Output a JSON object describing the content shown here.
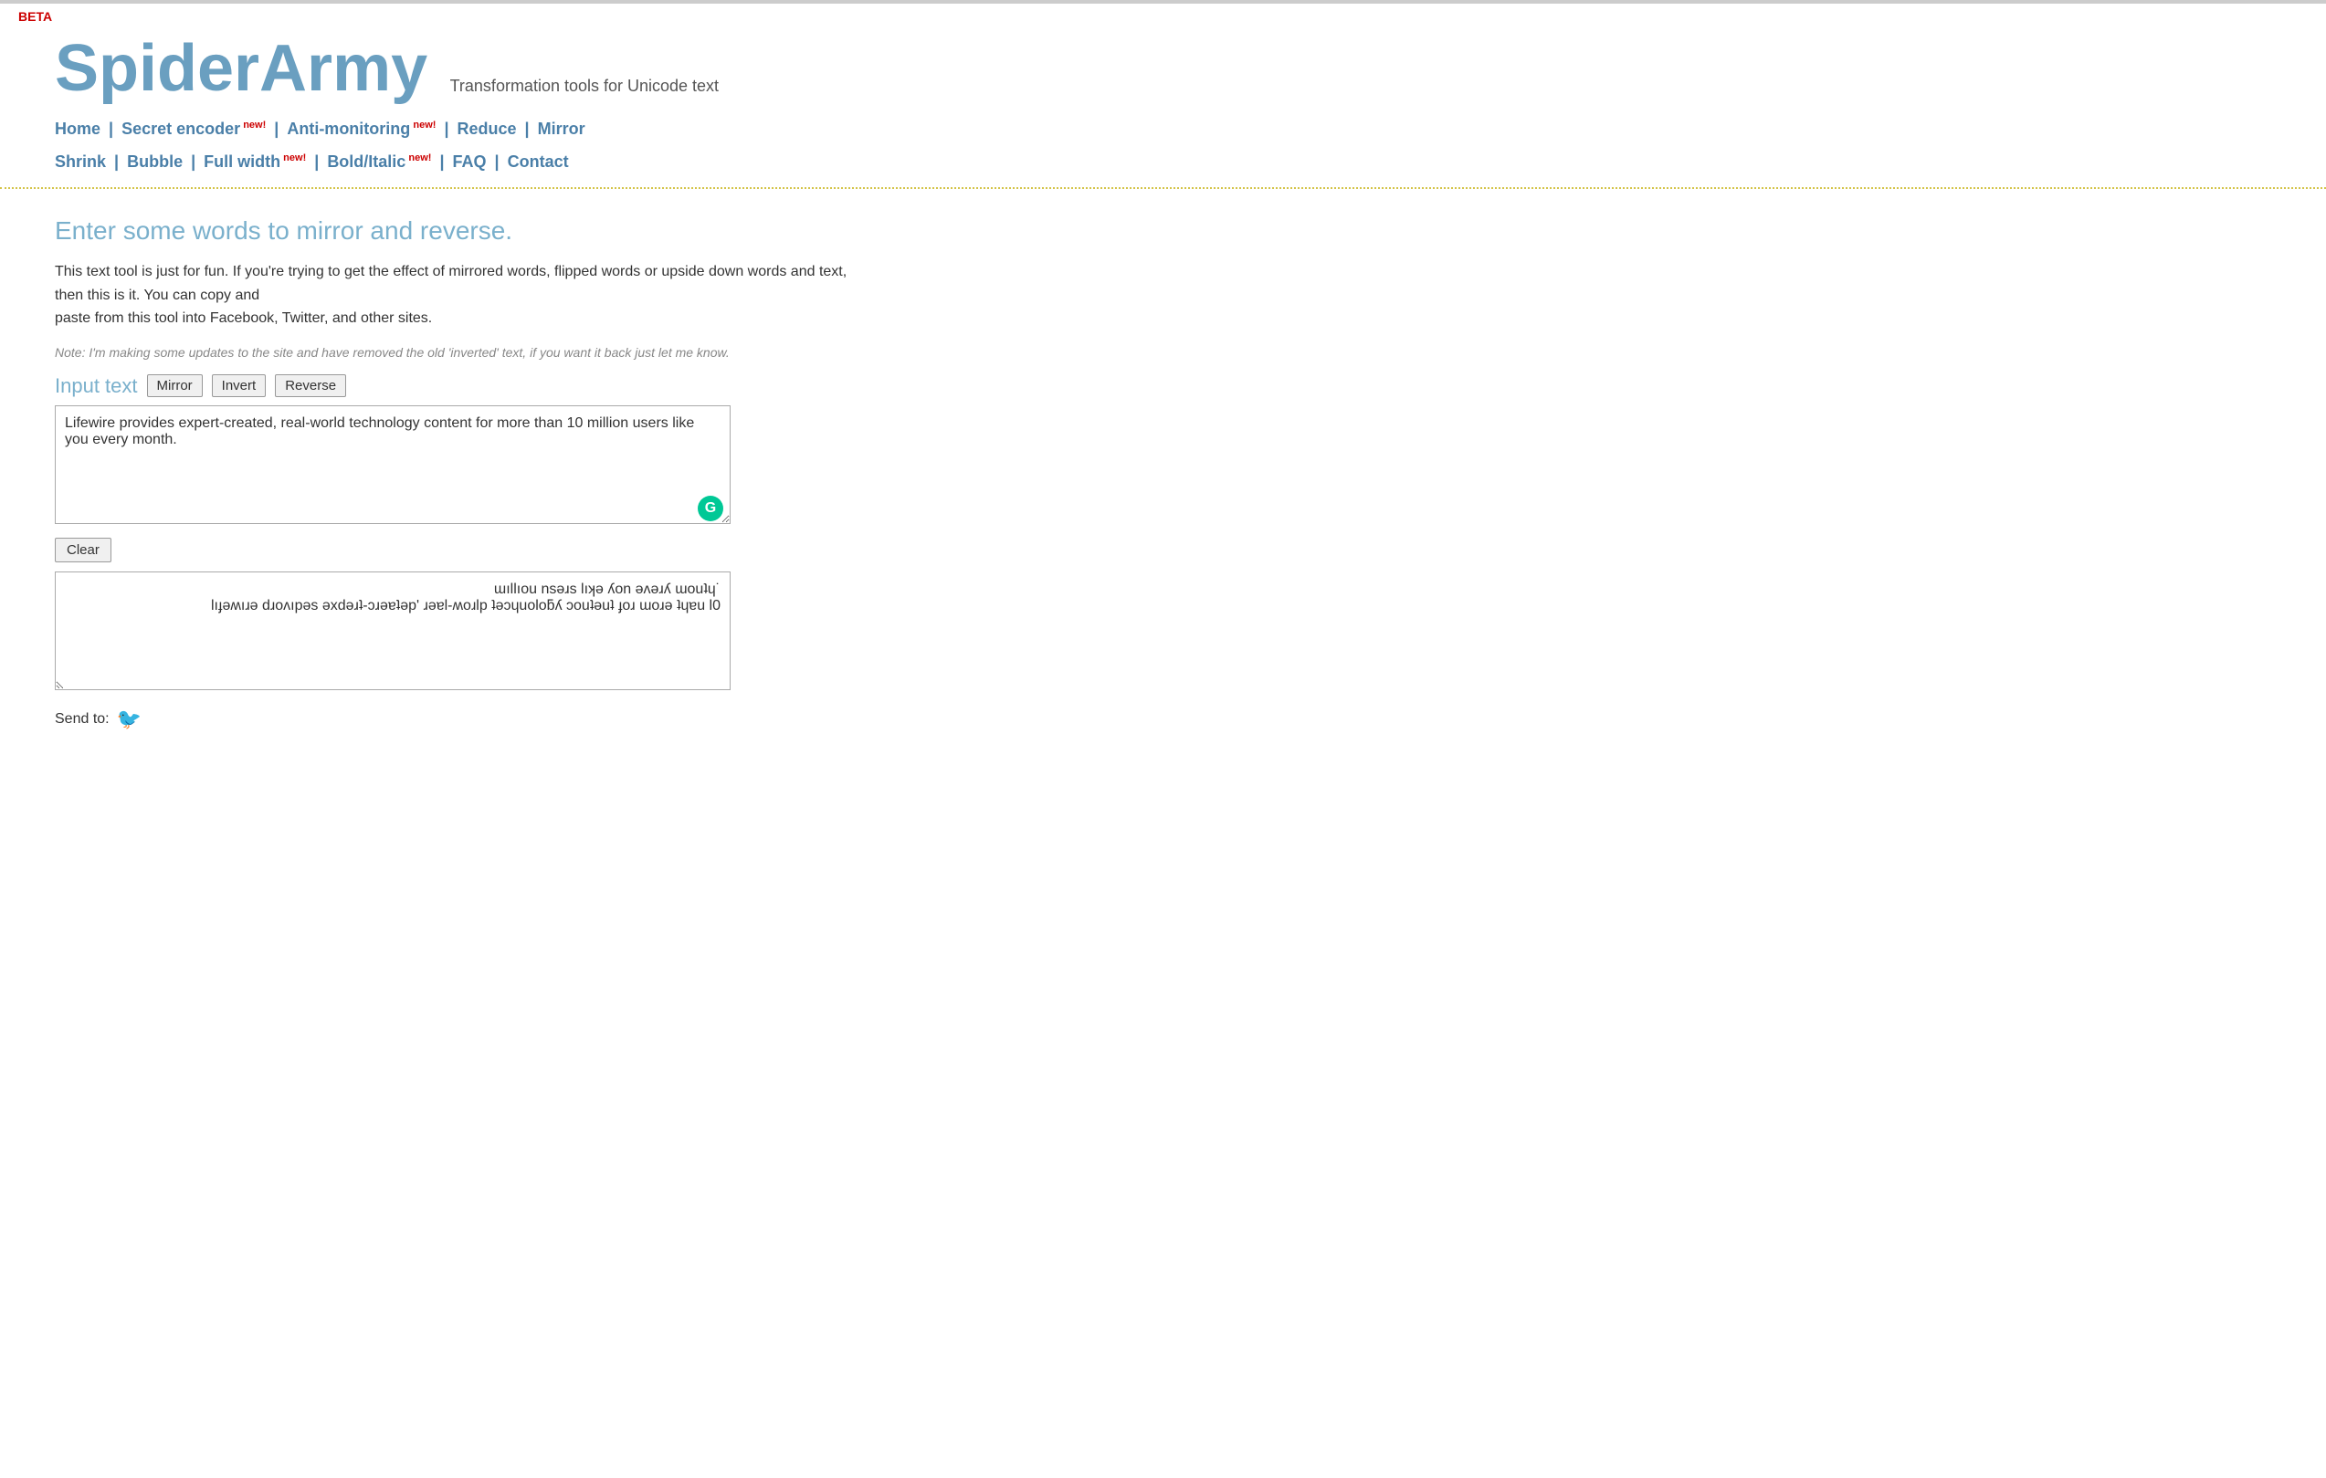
{
  "meta": {
    "beta_label": "BETA",
    "top_border": true
  },
  "header": {
    "site_title": "SpiderArmy",
    "tagline": "Transformation tools for Unicode text"
  },
  "nav": {
    "row1": [
      {
        "label": "Home",
        "new": false
      },
      {
        "label": "Secret encoder",
        "new": true
      },
      {
        "label": "Anti-monitoring",
        "new": true
      },
      {
        "label": "Reduce",
        "new": false
      },
      {
        "label": "Mirror",
        "new": false
      }
    ],
    "row2": [
      {
        "label": "Shrink",
        "new": false
      },
      {
        "label": "Bubble",
        "new": false
      },
      {
        "label": "Full width",
        "new": true
      },
      {
        "label": "Bold/Italic",
        "new": true
      },
      {
        "label": "FAQ",
        "new": false
      },
      {
        "label": "Contact",
        "new": false
      }
    ],
    "new_badge": "new!"
  },
  "main": {
    "heading": "Enter some words to mirror and reverse.",
    "description1": "This text tool is just for fun. If you're trying to get the effect of mirrored words, flipped words or upside down words and text, then this is it. You can copy and",
    "description2": "paste from this tool into Facebook, Twitter, and other sites.",
    "note": "Note: I'm making some updates to the site and have removed the old 'inverted' text, if you want it back just let me know.",
    "input_label": "Input text",
    "button_mirror": "Mirror",
    "button_invert": "Invert",
    "button_reverse": "Reverse",
    "input_value": "Lifewire provides expert-created, real-world technology content for more than 10 million users like you every month.",
    "output_value": "˙ɥʇuoɯ ʎɹǝʌǝ noʎ ǝʞıl sɹǝsn uoıllıɯ\n0l uɐɥʇ ǝɹoɯ ɹoɟ ʇuǝʇuoɔ ʎƃolouɥɔǝʇ plɹoʍ-lɐǝɹ 'pǝʇɐǝɹɔ-ʇɹǝdxǝ sǝpıʌoɹd ǝɹıʍǝɟıl",
    "clear_button": "Clear",
    "send_to_label": "Send to:"
  }
}
